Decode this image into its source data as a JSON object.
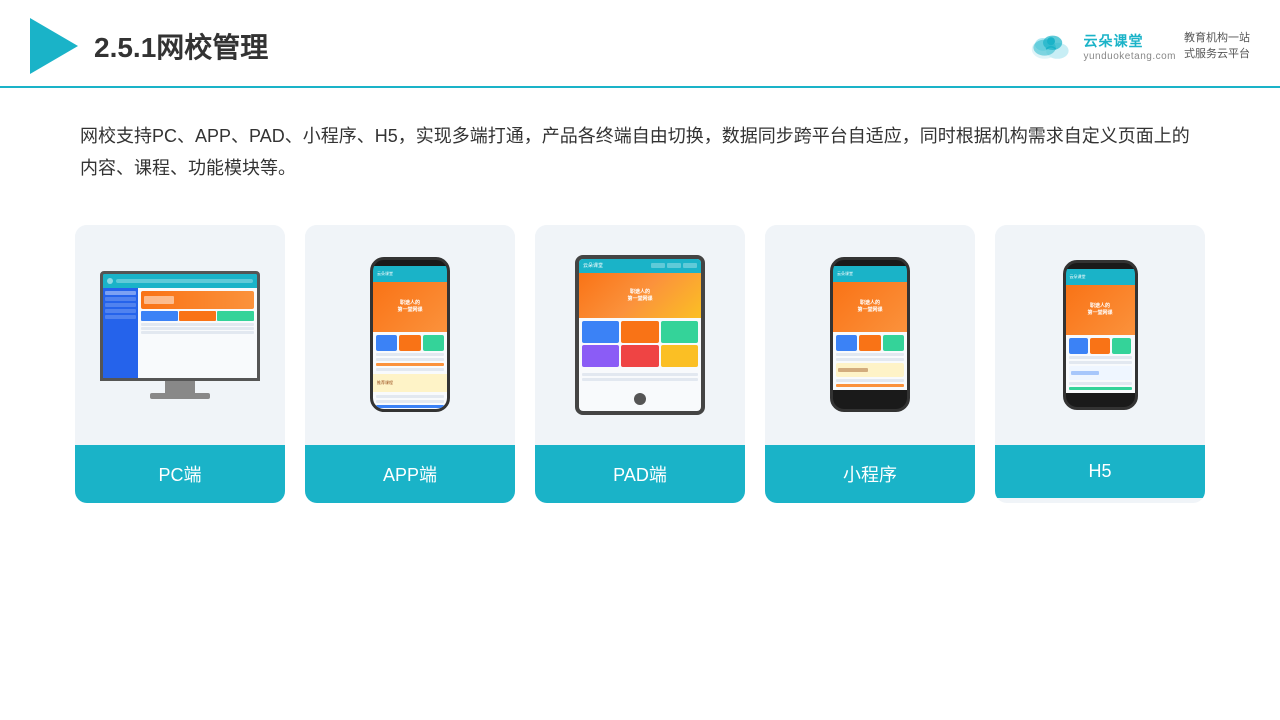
{
  "header": {
    "title": "2.5.1网校管理",
    "brand": {
      "name": "云朵课堂",
      "domain": "yunduoketang.com",
      "tagline": "教育机构一站\n式服务云平台"
    }
  },
  "description": {
    "text": "网校支持PC、APP、PAD、小程序、H5，实现多端打通，产品各终端自由切换，数据同步跨平台自适应，同时根据机构需求自定义页面上的内容、课程、功能模块等。"
  },
  "cards": [
    {
      "id": "pc",
      "label": "PC端"
    },
    {
      "id": "app",
      "label": "APP端"
    },
    {
      "id": "pad",
      "label": "PAD端"
    },
    {
      "id": "miniprogram",
      "label": "小程序"
    },
    {
      "id": "h5",
      "label": "H5"
    }
  ],
  "colors": {
    "teal": "#1ab3c8",
    "orange": "#f97316",
    "background": "#f0f4f8"
  }
}
